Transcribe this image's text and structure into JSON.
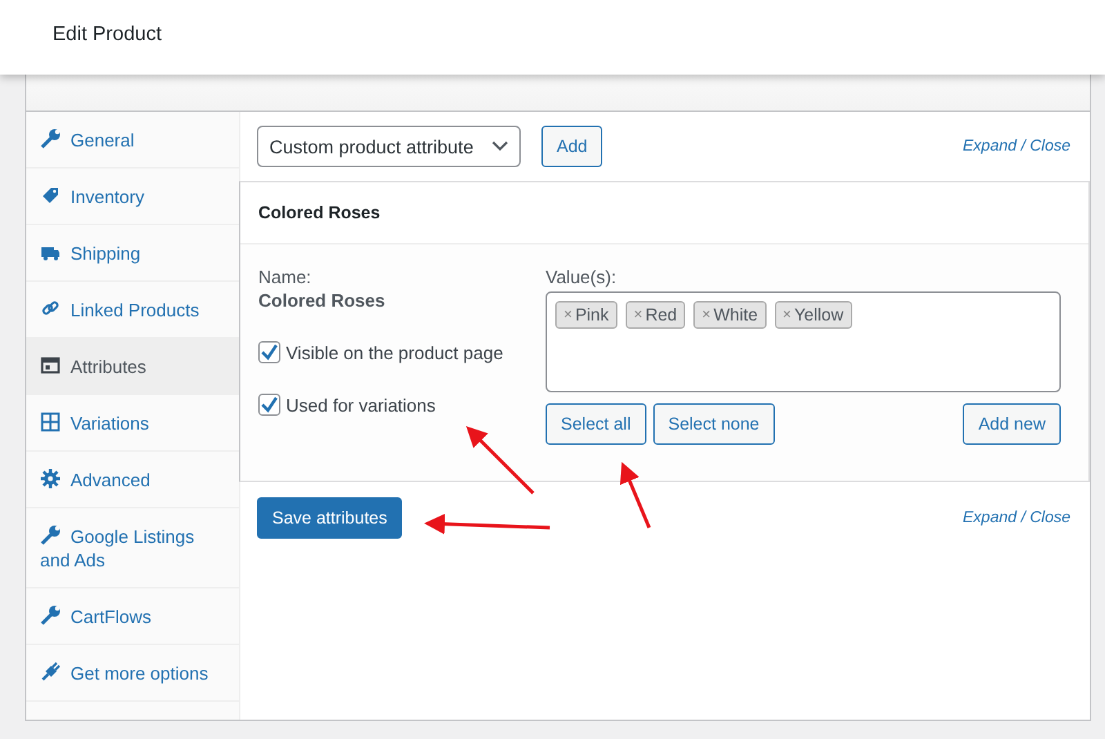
{
  "header": {
    "title": "Edit Product"
  },
  "sidebar": {
    "items": [
      {
        "label": "General",
        "selected": false
      },
      {
        "label": "Inventory",
        "selected": false
      },
      {
        "label": "Shipping",
        "selected": false
      },
      {
        "label": "Linked Products",
        "selected": false
      },
      {
        "label": "Attributes",
        "selected": true
      },
      {
        "label": "Variations",
        "selected": false
      },
      {
        "label": "Advanced",
        "selected": false
      },
      {
        "label": "Google Listings and Ads",
        "selected": false
      },
      {
        "label": "CartFlows",
        "selected": false
      },
      {
        "label": "Get more options",
        "selected": false
      }
    ]
  },
  "toolbar": {
    "attribute_select": "Custom product attribute",
    "add_button": "Add",
    "expand_close": "Expand / Close"
  },
  "attribute": {
    "title": "Colored Roses",
    "name_label": "Name:",
    "name_value": "Colored Roses",
    "checkboxes": [
      {
        "label": "Visible on the product page",
        "checked": true
      },
      {
        "label": "Used for variations",
        "checked": true
      }
    ],
    "values_label": "Value(s):",
    "values": [
      {
        "remove": "×",
        "label": "Pink"
      },
      {
        "remove": "×",
        "label": "Red"
      },
      {
        "remove": "×",
        "label": "White"
      },
      {
        "remove": "×",
        "label": "Yellow"
      }
    ],
    "buttons": [
      "Select all",
      "Select none"
    ],
    "add_new": "Add new"
  },
  "footer": {
    "save_button": "Save attributes",
    "expand_close": "Expand / Close"
  }
}
